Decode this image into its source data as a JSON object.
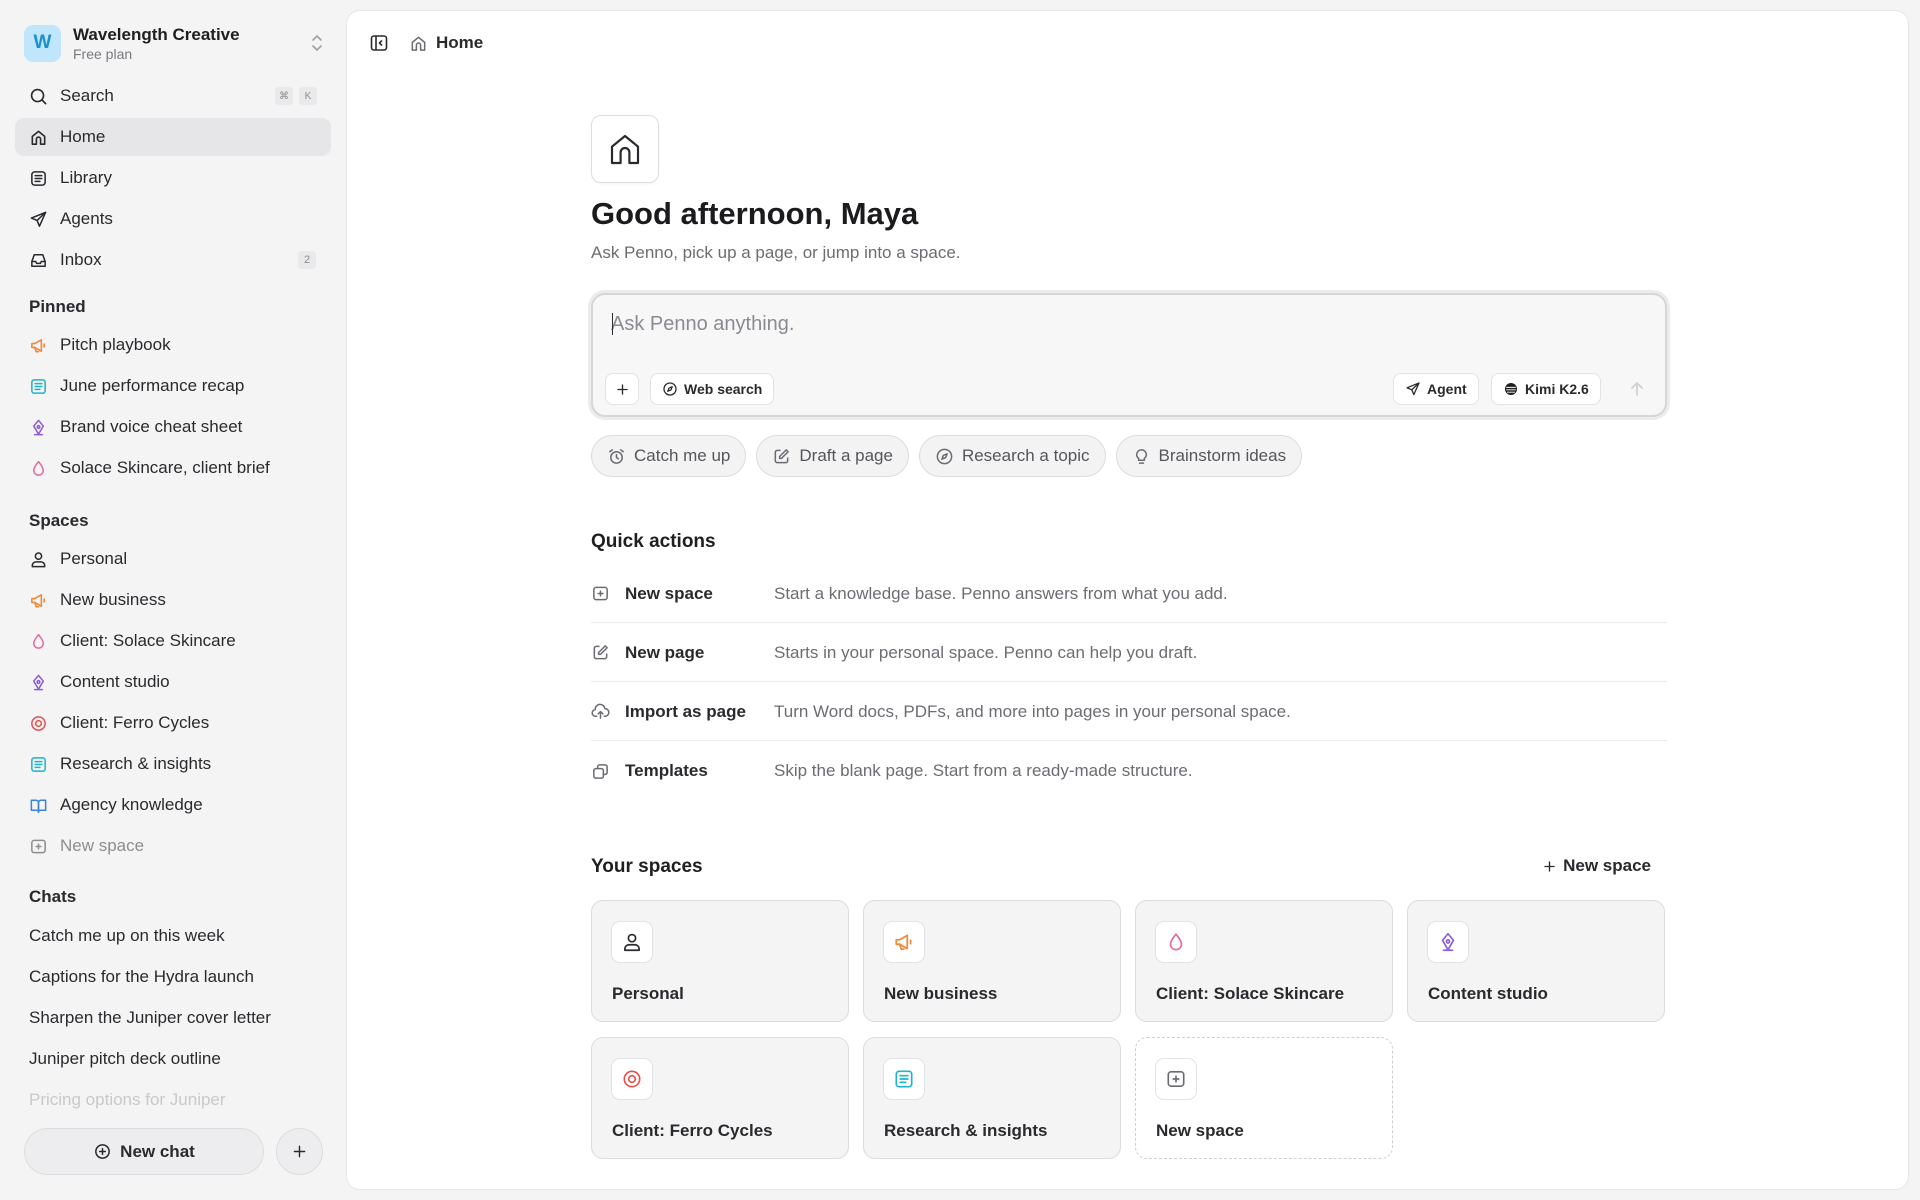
{
  "workspace": {
    "initial": "W",
    "name": "Wavelength Creative",
    "plan": "Free plan"
  },
  "nav": {
    "search": {
      "label": "Search",
      "shortcut": [
        "⌘",
        "K"
      ]
    },
    "home": "Home",
    "library": "Library",
    "agents": "Agents",
    "inbox": {
      "label": "Inbox",
      "count": "2"
    }
  },
  "pinned": {
    "title": "Pinned",
    "items": [
      {
        "label": "Pitch playbook",
        "icon": "megaphone-icon"
      },
      {
        "label": "June performance recap",
        "icon": "document-icon"
      },
      {
        "label": "Brand voice cheat sheet",
        "icon": "pen-nib-icon"
      },
      {
        "label": "Solace Skincare, client brief",
        "icon": "drop-icon"
      }
    ]
  },
  "spaces_nav": {
    "title": "Spaces",
    "items": [
      {
        "label": "Personal",
        "icon": "person-icon"
      },
      {
        "label": "New business",
        "icon": "megaphone-icon"
      },
      {
        "label": "Client: Solace Skincare",
        "icon": "drop-icon"
      },
      {
        "label": "Content studio",
        "icon": "pen-nib-icon"
      },
      {
        "label": "Client: Ferro Cycles",
        "icon": "target-icon"
      },
      {
        "label": "Research & insights",
        "icon": "document-icon"
      },
      {
        "label": "Agency knowledge",
        "icon": "book-icon"
      },
      {
        "label": "New space",
        "icon": "folder-plus-icon"
      }
    ]
  },
  "chats": {
    "title": "Chats",
    "items": [
      "Catch me up on this week",
      "Captions for the Hydra launch",
      "Sharpen the Juniper cover letter",
      "Juniper pitch deck outline",
      "Pricing options for Juniper"
    ]
  },
  "sidebar_bottom": {
    "new_chat": "New chat"
  },
  "breadcrumb": {
    "page": "Home"
  },
  "home": {
    "greeting": "Good afternoon, Maya",
    "subtitle": "Ask Penno, pick up a page, or jump into a space.",
    "composer": {
      "placeholder": "Ask Penno anything.",
      "web_search": "Web search",
      "agent": "Agent",
      "model": "Kimi K2.6"
    },
    "chips": [
      "Catch me up",
      "Draft a page",
      "Research a topic",
      "Brainstorm ideas"
    ],
    "quick_actions": {
      "title": "Quick actions",
      "items": [
        {
          "label": "New space",
          "desc": "Start a knowledge base. Penno answers from what you add."
        },
        {
          "label": "New page",
          "desc": "Starts in your personal space. Penno can help you draft."
        },
        {
          "label": "Import as page",
          "desc": "Turn Word docs, PDFs, and more into pages in your personal space."
        },
        {
          "label": "Templates",
          "desc": "Skip the blank page. Start from a ready-made structure."
        }
      ]
    },
    "your_spaces": {
      "title": "Your spaces",
      "new_space": "New space",
      "cards": [
        {
          "label": "Personal",
          "icon": "person-icon"
        },
        {
          "label": "New business",
          "icon": "megaphone-icon"
        },
        {
          "label": "Client: Solace Skincare",
          "icon": "drop-icon"
        },
        {
          "label": "Content studio",
          "icon": "pen-nib-icon"
        },
        {
          "label": "Client: Ferro Cycles",
          "icon": "target-icon"
        },
        {
          "label": "Research & insights",
          "icon": "document-icon"
        },
        {
          "label": "New space",
          "icon": "folder-plus-icon"
        }
      ]
    }
  },
  "colors": {
    "accent_orange": "#f08a3a",
    "accent_cyan": "#1fb2c9",
    "accent_purple": "#8a5cd6",
    "accent_pink": "#e46ba0",
    "accent_red": "#e8504f",
    "accent_blue": "#3a82d6"
  }
}
